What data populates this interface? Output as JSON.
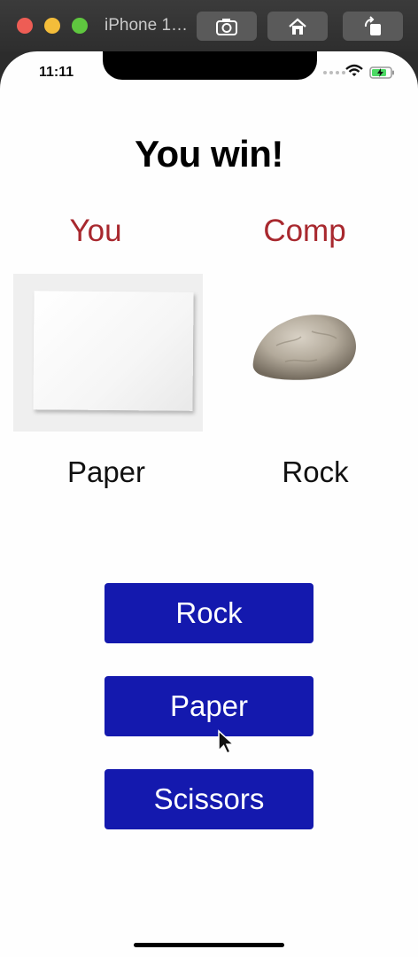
{
  "simulator": {
    "title": "iPhone 1…",
    "buttons": [
      {
        "icon": "screenshot-icon"
      },
      {
        "icon": "home-icon"
      },
      {
        "icon": "rotate-icon"
      }
    ]
  },
  "status_bar": {
    "time": "11:11",
    "icons": [
      "wifi-icon",
      "battery-charging-icon"
    ]
  },
  "game": {
    "result": "You win!",
    "player_label": "You",
    "computer_label": "Comp",
    "player_choice": "Paper",
    "computer_choice": "Rock",
    "player_image": "paper-image",
    "computer_image": "rock-image"
  },
  "buttons": {
    "rock": "Rock",
    "paper": "Paper",
    "scissors": "Scissors"
  },
  "colors": {
    "accent_label": "#a8282e",
    "button_bg": "#1419ae",
    "button_text": "#ffffff"
  }
}
